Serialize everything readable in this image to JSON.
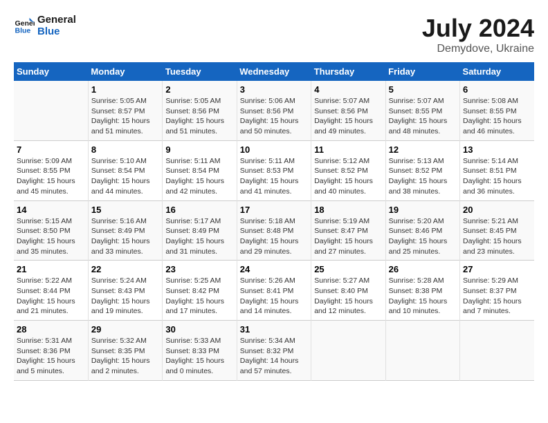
{
  "header": {
    "logo_line1": "General",
    "logo_line2": "Blue",
    "month": "July 2024",
    "location": "Demydove, Ukraine"
  },
  "columns": [
    "Sunday",
    "Monday",
    "Tuesday",
    "Wednesday",
    "Thursday",
    "Friday",
    "Saturday"
  ],
  "weeks": [
    [
      {
        "day": "",
        "info": ""
      },
      {
        "day": "1",
        "info": "Sunrise: 5:05 AM\nSunset: 8:57 PM\nDaylight: 15 hours\nand 51 minutes."
      },
      {
        "day": "2",
        "info": "Sunrise: 5:05 AM\nSunset: 8:56 PM\nDaylight: 15 hours\nand 51 minutes."
      },
      {
        "day": "3",
        "info": "Sunrise: 5:06 AM\nSunset: 8:56 PM\nDaylight: 15 hours\nand 50 minutes."
      },
      {
        "day": "4",
        "info": "Sunrise: 5:07 AM\nSunset: 8:56 PM\nDaylight: 15 hours\nand 49 minutes."
      },
      {
        "day": "5",
        "info": "Sunrise: 5:07 AM\nSunset: 8:55 PM\nDaylight: 15 hours\nand 48 minutes."
      },
      {
        "day": "6",
        "info": "Sunrise: 5:08 AM\nSunset: 8:55 PM\nDaylight: 15 hours\nand 46 minutes."
      }
    ],
    [
      {
        "day": "7",
        "info": "Sunrise: 5:09 AM\nSunset: 8:55 PM\nDaylight: 15 hours\nand 45 minutes."
      },
      {
        "day": "8",
        "info": "Sunrise: 5:10 AM\nSunset: 8:54 PM\nDaylight: 15 hours\nand 44 minutes."
      },
      {
        "day": "9",
        "info": "Sunrise: 5:11 AM\nSunset: 8:54 PM\nDaylight: 15 hours\nand 42 minutes."
      },
      {
        "day": "10",
        "info": "Sunrise: 5:11 AM\nSunset: 8:53 PM\nDaylight: 15 hours\nand 41 minutes."
      },
      {
        "day": "11",
        "info": "Sunrise: 5:12 AM\nSunset: 8:52 PM\nDaylight: 15 hours\nand 40 minutes."
      },
      {
        "day": "12",
        "info": "Sunrise: 5:13 AM\nSunset: 8:52 PM\nDaylight: 15 hours\nand 38 minutes."
      },
      {
        "day": "13",
        "info": "Sunrise: 5:14 AM\nSunset: 8:51 PM\nDaylight: 15 hours\nand 36 minutes."
      }
    ],
    [
      {
        "day": "14",
        "info": "Sunrise: 5:15 AM\nSunset: 8:50 PM\nDaylight: 15 hours\nand 35 minutes."
      },
      {
        "day": "15",
        "info": "Sunrise: 5:16 AM\nSunset: 8:49 PM\nDaylight: 15 hours\nand 33 minutes."
      },
      {
        "day": "16",
        "info": "Sunrise: 5:17 AM\nSunset: 8:49 PM\nDaylight: 15 hours\nand 31 minutes."
      },
      {
        "day": "17",
        "info": "Sunrise: 5:18 AM\nSunset: 8:48 PM\nDaylight: 15 hours\nand 29 minutes."
      },
      {
        "day": "18",
        "info": "Sunrise: 5:19 AM\nSunset: 8:47 PM\nDaylight: 15 hours\nand 27 minutes."
      },
      {
        "day": "19",
        "info": "Sunrise: 5:20 AM\nSunset: 8:46 PM\nDaylight: 15 hours\nand 25 minutes."
      },
      {
        "day": "20",
        "info": "Sunrise: 5:21 AM\nSunset: 8:45 PM\nDaylight: 15 hours\nand 23 minutes."
      }
    ],
    [
      {
        "day": "21",
        "info": "Sunrise: 5:22 AM\nSunset: 8:44 PM\nDaylight: 15 hours\nand 21 minutes."
      },
      {
        "day": "22",
        "info": "Sunrise: 5:24 AM\nSunset: 8:43 PM\nDaylight: 15 hours\nand 19 minutes."
      },
      {
        "day": "23",
        "info": "Sunrise: 5:25 AM\nSunset: 8:42 PM\nDaylight: 15 hours\nand 17 minutes."
      },
      {
        "day": "24",
        "info": "Sunrise: 5:26 AM\nSunset: 8:41 PM\nDaylight: 15 hours\nand 14 minutes."
      },
      {
        "day": "25",
        "info": "Sunrise: 5:27 AM\nSunset: 8:40 PM\nDaylight: 15 hours\nand 12 minutes."
      },
      {
        "day": "26",
        "info": "Sunrise: 5:28 AM\nSunset: 8:38 PM\nDaylight: 15 hours\nand 10 minutes."
      },
      {
        "day": "27",
        "info": "Sunrise: 5:29 AM\nSunset: 8:37 PM\nDaylight: 15 hours\nand 7 minutes."
      }
    ],
    [
      {
        "day": "28",
        "info": "Sunrise: 5:31 AM\nSunset: 8:36 PM\nDaylight: 15 hours\nand 5 minutes."
      },
      {
        "day": "29",
        "info": "Sunrise: 5:32 AM\nSunset: 8:35 PM\nDaylight: 15 hours\nand 2 minutes."
      },
      {
        "day": "30",
        "info": "Sunrise: 5:33 AM\nSunset: 8:33 PM\nDaylight: 15 hours\nand 0 minutes."
      },
      {
        "day": "31",
        "info": "Sunrise: 5:34 AM\nSunset: 8:32 PM\nDaylight: 14 hours\nand 57 minutes."
      },
      {
        "day": "",
        "info": ""
      },
      {
        "day": "",
        "info": ""
      },
      {
        "day": "",
        "info": ""
      }
    ]
  ]
}
